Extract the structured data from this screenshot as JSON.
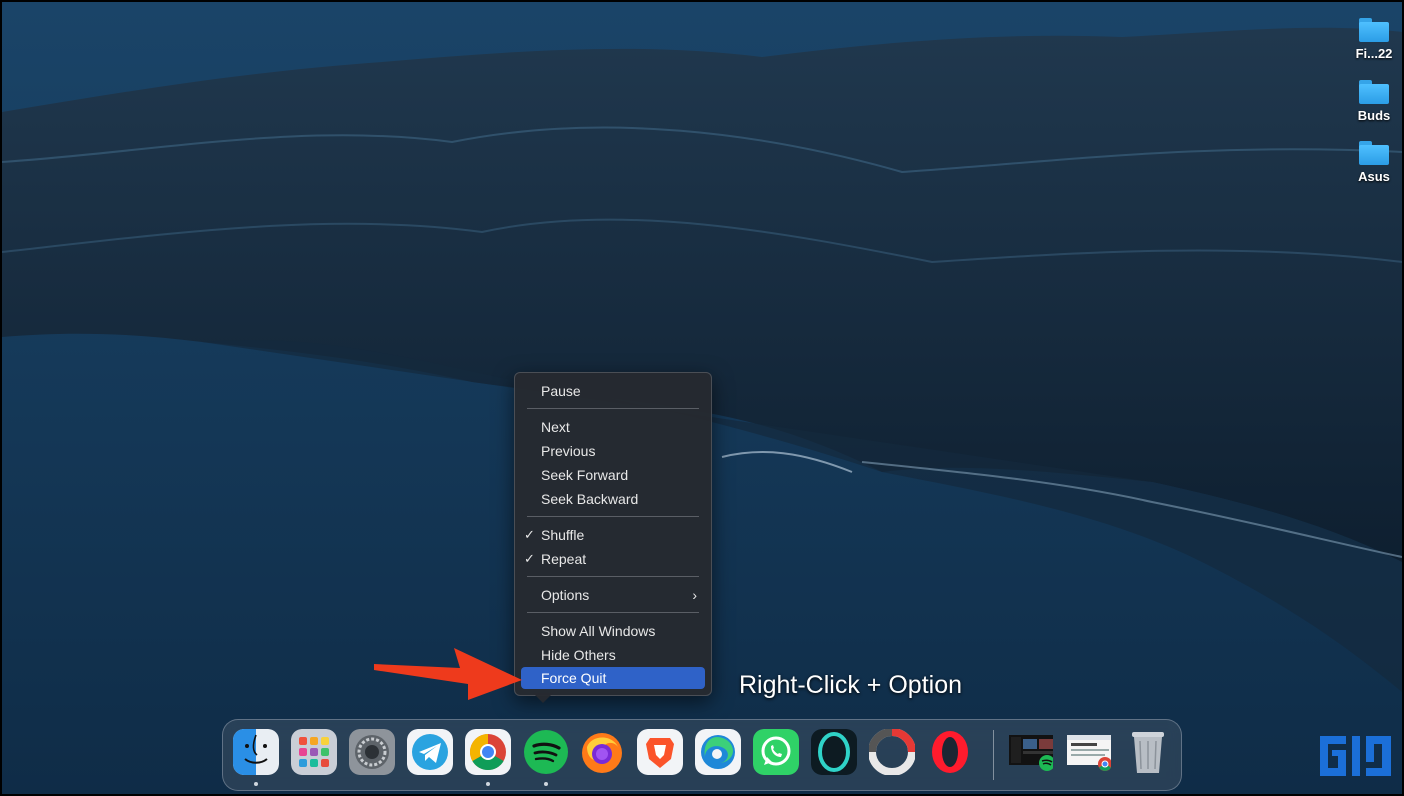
{
  "desktop": {
    "items": [
      {
        "label": "Fi...22"
      },
      {
        "label": "Buds"
      },
      {
        "label": "Asus"
      }
    ]
  },
  "context_menu": {
    "items": [
      {
        "label": "Pause"
      },
      {
        "label": "Next"
      },
      {
        "label": "Previous"
      },
      {
        "label": "Seek Forward"
      },
      {
        "label": "Seek Backward"
      },
      {
        "label": "Shuffle",
        "checked": true
      },
      {
        "label": "Repeat",
        "checked": true
      },
      {
        "label": "Options",
        "submenu": true
      },
      {
        "label": "Show All Windows"
      },
      {
        "label": "Hide Others"
      },
      {
        "label": "Force Quit",
        "highlighted": true
      }
    ],
    "check_glyph": "✓",
    "submenu_glyph": "›"
  },
  "annotation": {
    "caption": "Right-Click + Option",
    "arrow_color": "#ee3a1c"
  },
  "dock": {
    "apps": [
      {
        "icon": "finder-icon",
        "running": true
      },
      {
        "icon": "launchpad-icon",
        "running": false
      },
      {
        "icon": "system-preferences-icon",
        "running": false
      },
      {
        "icon": "telegram-icon",
        "running": false
      },
      {
        "icon": "chrome-icon",
        "running": true
      },
      {
        "icon": "spotify-icon",
        "running": true
      },
      {
        "icon": "firefox-icon",
        "running": false
      },
      {
        "icon": "brave-icon",
        "running": false
      },
      {
        "icon": "edge-icon",
        "running": false
      },
      {
        "icon": "whatsapp-icon",
        "running": false
      },
      {
        "icon": "opera-gx-icon",
        "running": false
      },
      {
        "icon": "screen-recorder-icon",
        "running": false
      },
      {
        "icon": "opera-icon",
        "running": false
      },
      {
        "icon": "spotify-window-thumbnail-icon",
        "running": false
      },
      {
        "icon": "chrome-window-thumbnail-icon",
        "running": false
      },
      {
        "icon": "trash-icon",
        "running": false
      }
    ]
  },
  "colors": {
    "menu_highlight": "#2f62c8",
    "spotify_green": "#1db954",
    "brand_blue": "#1b6fd8"
  }
}
